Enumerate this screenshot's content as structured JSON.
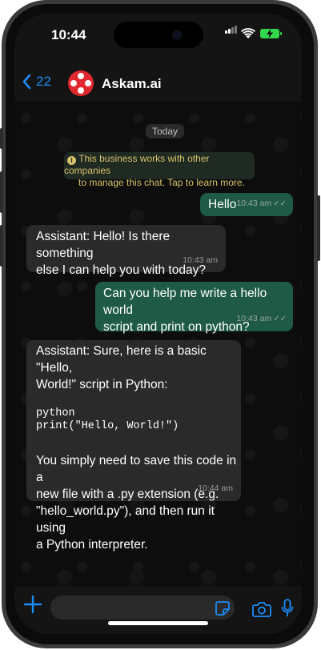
{
  "status_bar": {
    "time": "10:44",
    "battery_color": "#32d74b"
  },
  "header": {
    "back_count": "22",
    "chat_name": "Askam.ai",
    "avatar_color": "#e0282e",
    "back_icon": "chevron-left-icon"
  },
  "chat": {
    "date_label": "Today",
    "notice_line1": "This business works with other companies",
    "notice_line2": "to manage this chat. Tap to learn more.",
    "messages": [
      {
        "direction": "out",
        "text": "Hello",
        "time": "10:43 am",
        "status": "read"
      },
      {
        "direction": "in",
        "line1": "Assistant: Hello! Is there something",
        "line2": "else I can help you with today?",
        "time": "10:43 am"
      },
      {
        "direction": "out",
        "line1": "Can you help me write a hello world",
        "line2": "script and print on python?",
        "time": "10:43 am",
        "status": "read"
      },
      {
        "direction": "in",
        "line1": "Assistant: Sure, here is a basic \"Hello,",
        "line2": "World!\" script in Python:",
        "code_line1": "python",
        "code_line2": "print(\"Hello, World!\")",
        "line3": "You simply need to save this code in a",
        "line4": "new file with a .py extension (e.g.",
        "line5": "\"hello_world.py\"), and then run it using",
        "line6": "a Python interpreter.",
        "time": "10:44 am"
      }
    ]
  },
  "composer": {
    "input_value": "",
    "icons": [
      "plus-icon",
      "sticker-icon",
      "camera-icon",
      "microphone-icon"
    ],
    "accent_color": "#1d8cf8"
  },
  "colors": {
    "outgoing_bubble": "#1e5a46",
    "incoming_bubble": "#2a2a2a",
    "background": "#0d0d0d"
  }
}
